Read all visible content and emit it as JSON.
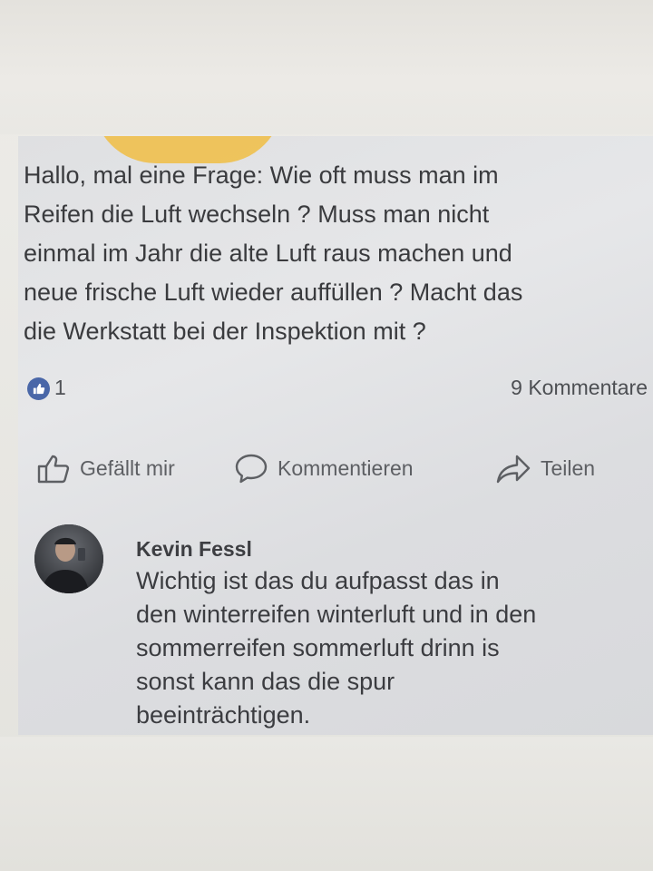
{
  "post": {
    "text": "Hallo, mal eine Frage: Wie oft muss man im\nReifen die Luft wechseln ? Muss man nicht\neinmal im Jahr die alte Luft raus machen und\nneue frische Luft wieder auffüllen ? Macht das\ndie Werkstatt bei der Inspektion mit ?",
    "like_count": "1",
    "comment_count": "9 Kommentare"
  },
  "actions": {
    "like_label": "Gefällt mir",
    "comment_label": "Kommentieren",
    "share_label": "Teilen"
  },
  "comment": {
    "author": "Kevin Fessl",
    "text": "Wichtig ist das du aufpasst das in\nden winterreifen winterluft und in den\nsommerreifen sommerluft drinn is\nsonst kann das die spur\nbeeinträchtigen."
  },
  "colors": {
    "like_badge": "#4a67a8",
    "text": "#3a3b3e",
    "action_text": "#5d5f63"
  },
  "icons": {
    "like_badge": "thumbs-up-icon",
    "like_action": "thumbs-up-outline-icon",
    "comment_action": "speech-bubble-icon",
    "share_action": "share-arrow-icon"
  }
}
